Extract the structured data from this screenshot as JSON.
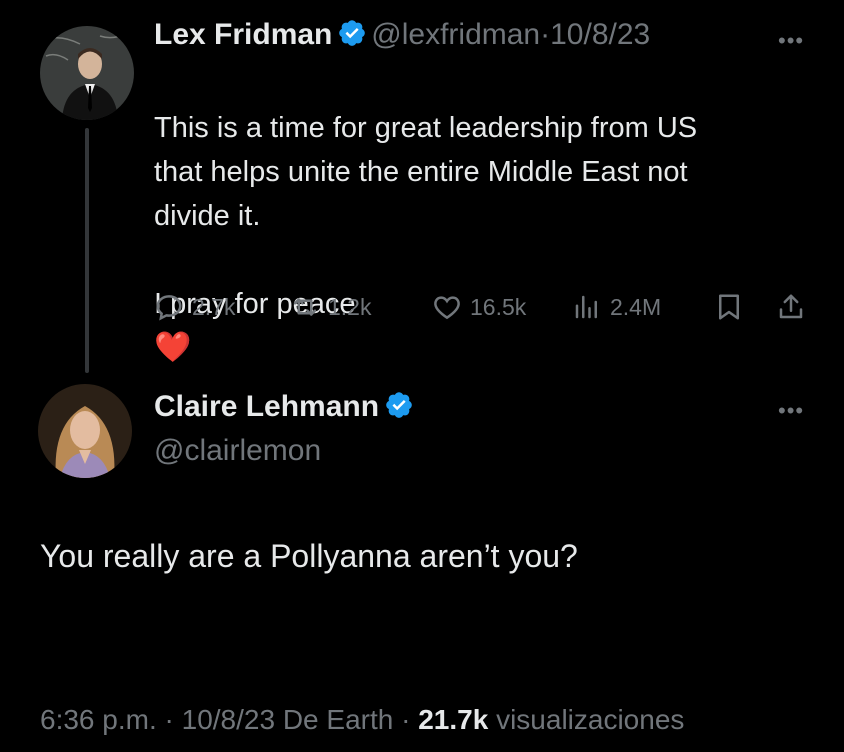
{
  "colors": {
    "background": "#000000",
    "text": "#e7e9ea",
    "muted": "#71767b",
    "verified": "#1d9bf0",
    "heart": "#e0245e"
  },
  "parent_tweet": {
    "author": {
      "name": "Lex Fridman",
      "handle": "@lexfridman",
      "verified": true
    },
    "date": "10/8/23",
    "separator": "·",
    "text": "This is a time for great leadership from US\nthat helps unite the entire Middle East not\ndivide it.\n\nI pray for peace",
    "emoji": "❤️",
    "actions": {
      "replies": "2.7k",
      "retweets": "1.2k",
      "likes": "16.5k",
      "views": "2.4M"
    }
  },
  "reply_tweet": {
    "author": {
      "name": "Claire Lehmann",
      "handle": "@clairlemon",
      "verified": true
    },
    "text": "You really are a Pollyanna aren’t you?",
    "meta": {
      "time": "6:36 p.m.",
      "date": "10/8/23",
      "source": "De Earth",
      "views_count": "21.7k",
      "views_label": "visualizaciones",
      "separator": "·"
    }
  },
  "icons": [
    "verified-badge-icon",
    "more-icon",
    "reply-icon",
    "retweet-icon",
    "like-icon",
    "views-icon",
    "bookmark-icon",
    "share-icon"
  ]
}
